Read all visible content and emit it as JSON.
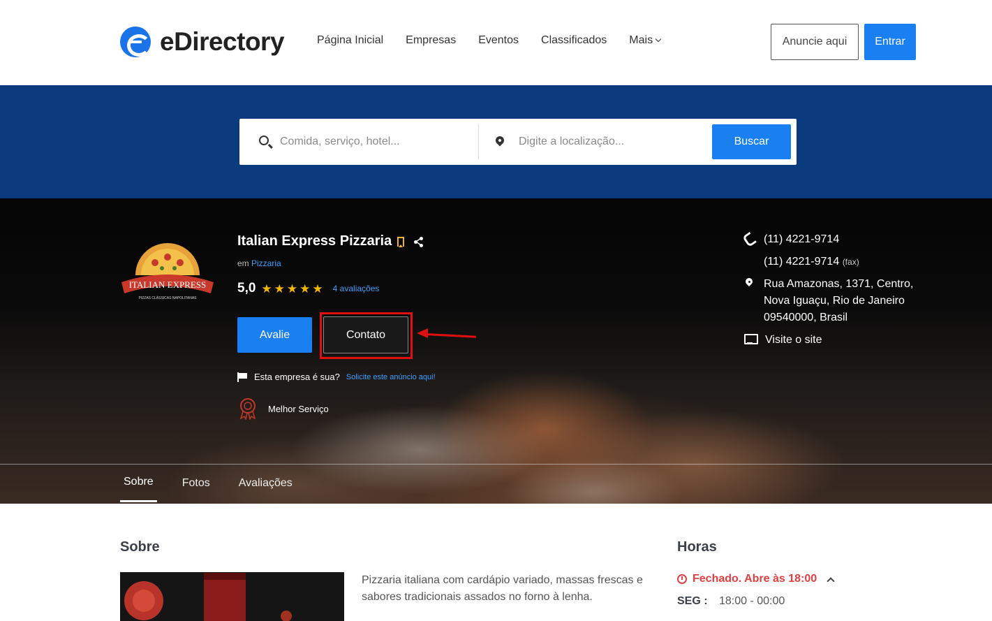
{
  "brand": {
    "name": "eDirectory"
  },
  "nav": {
    "items": [
      "Página Inicial",
      "Empresas",
      "Eventos",
      "Classificados",
      "Mais"
    ]
  },
  "header": {
    "advertise_label": "Anuncie aqui",
    "login_label": "Entrar"
  },
  "search": {
    "query_placeholder": "Comida, serviço, hotel...",
    "location_placeholder": "Digite a localização...",
    "button_label": "Buscar"
  },
  "listing": {
    "name": "Italian Express Pizzaria",
    "category_prefix": "em",
    "category": "Pizzaria",
    "rating": "5,0",
    "stars": 5,
    "reviews_link": "4 avaliações",
    "review_button": "Avalie",
    "contact_button": "Contato",
    "claim_question": "Esta empresa é sua?",
    "claim_link": "Solicite este anúncio aqui!",
    "badge_label": "Melhor Serviço",
    "logo_text": "ITALIAN EXPRESS",
    "logo_subtext": "PIZZAS CLÁSSICAS NAPOLITANAS"
  },
  "contact": {
    "phone": "(11) 4221-9714",
    "fax": "(11) 4221-9714",
    "fax_label": "(fax)",
    "address_line1": "Rua Amazonas, 1371, Centro,",
    "address_line2": "Nova Iguaçu, Rio de Janeiro",
    "address_line3": "09540000, Brasil",
    "website_label": "Visite o site"
  },
  "tabs": [
    "Sobre",
    "Fotos",
    "Avaliações"
  ],
  "about": {
    "title": "Sobre",
    "text": "Pizzaria italiana com cardápio variado, massas frescas e sabores tradicionais assados no forno à lenha."
  },
  "hours": {
    "title": "Horas",
    "status": "Fechado. Abre às 18:00",
    "days": [
      {
        "day": "SEG :",
        "time": "18:00 - 00:00"
      }
    ]
  },
  "colors": {
    "accent": "#1a7ff0",
    "search_band": "#0b3a7e",
    "star": "#f5b700",
    "link": "#3fa0ff",
    "closed": "#e04040",
    "highlight": "#e01010"
  }
}
